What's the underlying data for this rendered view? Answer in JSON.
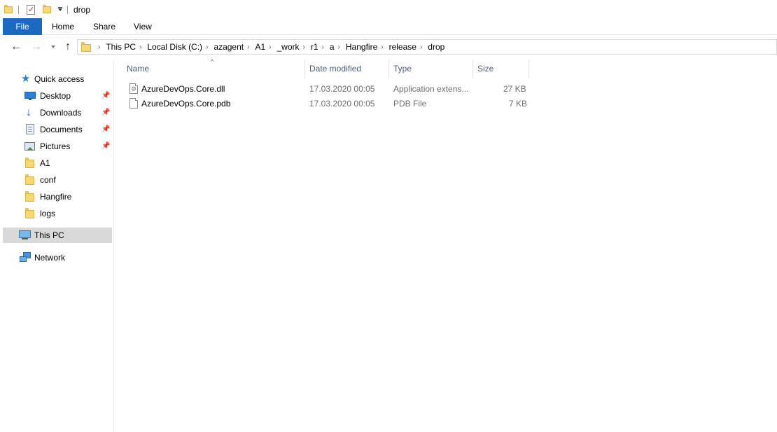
{
  "window": {
    "title": "drop"
  },
  "ribbon": {
    "tabs": [
      {
        "label": "File"
      },
      {
        "label": "Home"
      },
      {
        "label": "Share"
      },
      {
        "label": "View"
      }
    ],
    "file_color": "#1b6ac1"
  },
  "address": {
    "crumbs": [
      "This PC",
      "Local Disk (C:)",
      "azagent",
      "A1",
      "_work",
      "r1",
      "a",
      "Hangfire",
      "release",
      "drop"
    ]
  },
  "navpane": {
    "items": [
      {
        "label": "Quick access",
        "icon": "star-icon"
      },
      {
        "label": "Desktop",
        "icon": "desktop-icon",
        "pinned": true
      },
      {
        "label": "Downloads",
        "icon": "downloads-icon",
        "pinned": true
      },
      {
        "label": "Documents",
        "icon": "documents-icon",
        "pinned": true
      },
      {
        "label": "Pictures",
        "icon": "pictures-icon",
        "pinned": true
      },
      {
        "label": "A1",
        "icon": "folder-icon"
      },
      {
        "label": "conf",
        "icon": "folder-icon"
      },
      {
        "label": "Hangfire",
        "icon": "folder-icon"
      },
      {
        "label": "logs",
        "icon": "folder-icon"
      },
      {
        "label": "This PC",
        "icon": "this-pc-icon",
        "selected": true
      },
      {
        "label": "Network",
        "icon": "network-icon"
      }
    ]
  },
  "filelist": {
    "columns": [
      "Name",
      "Date modified",
      "Type",
      "Size"
    ],
    "sorted_by": "Name",
    "rows": [
      {
        "name": "AzureDevOps.Core.dll",
        "date": "17.03.2020 00:05",
        "type": "Application extens...",
        "size": "27 KB",
        "icon": "dll-file-icon"
      },
      {
        "name": "AzureDevOps.Core.pdb",
        "date": "17.03.2020 00:05",
        "type": "PDB File",
        "size": "7 KB",
        "icon": "file-icon"
      }
    ]
  }
}
